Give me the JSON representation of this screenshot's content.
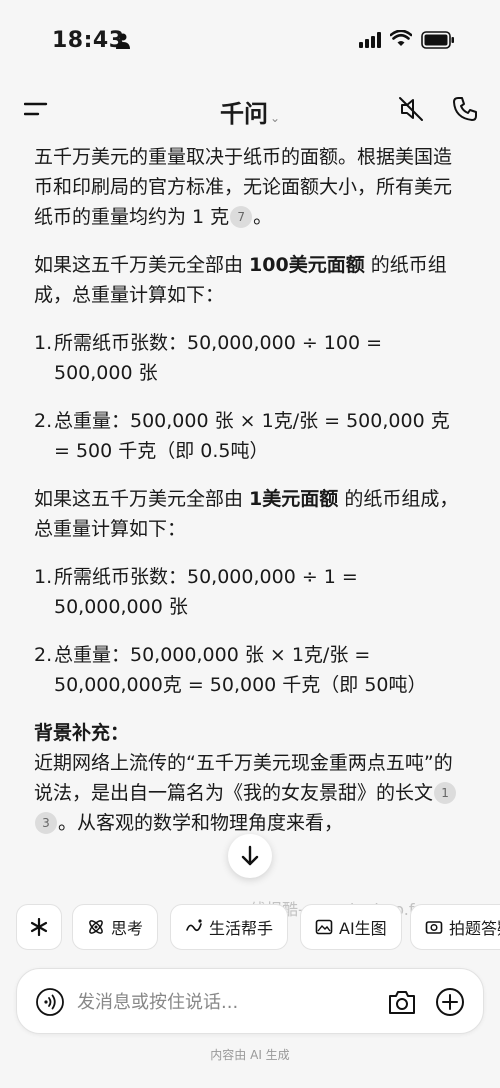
{
  "status_bar": {
    "time": "18:43"
  },
  "nav": {
    "title": "千问",
    "chevron": "⌄"
  },
  "content": {
    "p1_text": "五千万美元的重量取决于纸币的面额。根据美国造币和印刷局的官方标准，无论面额大小，所有美元纸币的重量均约为 1 克",
    "p1_cite": "7",
    "p1_end": "。",
    "p2_pre": "如果这五千万美元全部由 ",
    "p2_bold": "100美元面额",
    "p2_post": " 的纸币组成，总重量计算如下：",
    "list1": [
      {
        "num": "1.",
        "text": "所需纸币张数：50,000,000 ÷ 100 = 500,000 张"
      },
      {
        "num": "2.",
        "text": "总重量：500,000 张 × 1克/张 = 500,000 克 = 500 千克（即 0.5吨）"
      }
    ],
    "p3_pre": "如果这五千万美元全部由 ",
    "p3_bold": "1美元面额",
    "p3_post": " 的纸币组成，总重量计算如下：",
    "list2": [
      {
        "num": "1.",
        "text": "所需纸币张数：50,000,000 ÷ 1 = 50,000,000 张"
      },
      {
        "num": "2.",
        "text": "总重量：50,000,000 张 × 1克/张 = 50,000,000克 = 50,000 千克（即 50吨）"
      }
    ],
    "section_title": "背景补充：",
    "p4_text": "近期网络上流传的“五千万美元现金重两点五吨”的说法，是出自一篇名为《我的女友景甜》的长文",
    "p4_cite1": "1",
    "p4_cite2": "3",
    "p4_end": "。从客观的数学和物理角度来看，"
  },
  "chips": [
    {
      "label": "思考",
      "icon": "atom-icon"
    },
    {
      "label": "生活帮手",
      "icon": "life-icon"
    },
    {
      "label": "AI生图",
      "icon": "image-icon"
    },
    {
      "label": "拍题答疑",
      "icon": "camera-icon"
    }
  ],
  "input": {
    "placeholder": "发消息或按住说话..."
  },
  "footer": {
    "note": "内容由 AI 生成"
  },
  "watermark": "线报酷-new.xianbao.fun",
  "colors": {
    "background": "#f6f6f6",
    "text": "#1a1a1a",
    "chip_bg": "#ffffff",
    "cite_bg": "#dcdcdc"
  }
}
